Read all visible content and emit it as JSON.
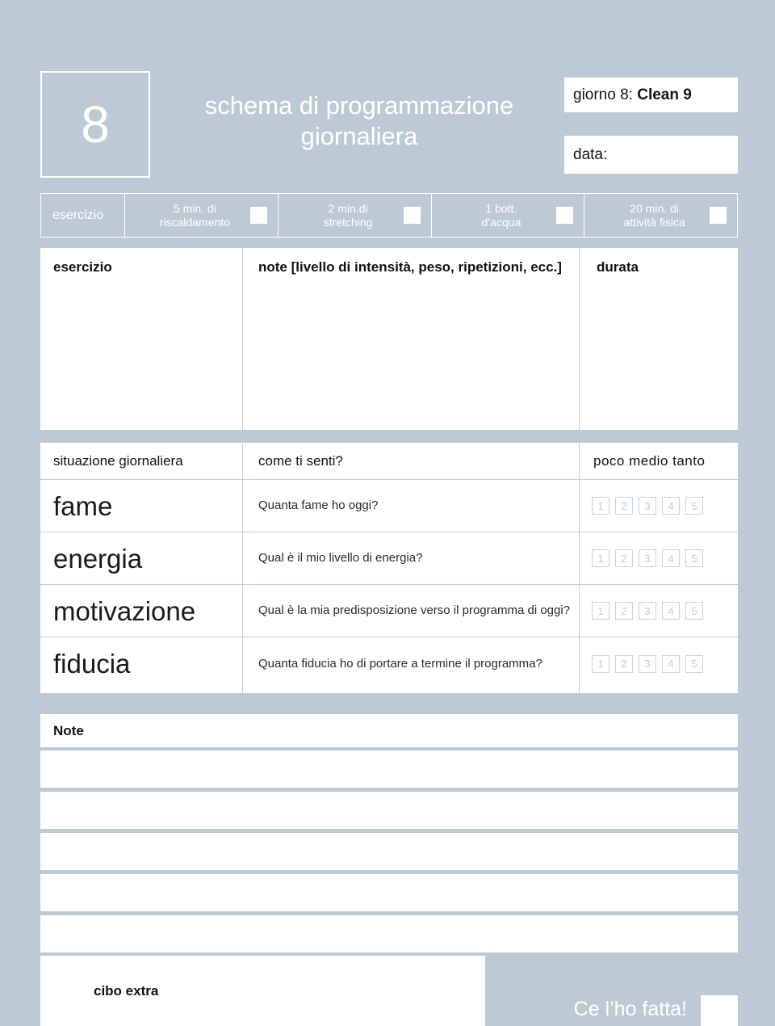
{
  "header": {
    "day_number": "8",
    "title_line1": "schema di programmazione",
    "title_line2": "giornaliera",
    "day_label_prefix": "giorno 8: ",
    "day_label_program": "Clean 9",
    "date_label": "data:"
  },
  "checklist": {
    "section_label": "esercizio",
    "tasks": [
      {
        "line1": "5 min. di",
        "line2": "riscaldamento",
        "checked": false
      },
      {
        "line1": "2 min.di",
        "line2": "stretching",
        "checked": false
      },
      {
        "line1": "1 bott.",
        "line2": "d’acqua",
        "checked": false
      },
      {
        "line1": "20 min. di",
        "line2": "attività fisica",
        "checked": false
      }
    ]
  },
  "exercise_table": {
    "col1_header": "esercizio",
    "col2_header": "note [livello di intensità, peso, ripetizioni, ecc.]",
    "col3_header": "durata",
    "rows": []
  },
  "situation_table": {
    "col1_header": "situazione giornaliera",
    "col2_header": "come ti senti?",
    "scale_header": "poco  medio  tanto",
    "scale_values": [
      "1",
      "2",
      "3",
      "4",
      "5"
    ],
    "rows": [
      {
        "name": "fame",
        "question": "Quanta fame ho oggi?",
        "selected": null
      },
      {
        "name": "energia",
        "question": "Qual è il mio livello di energia?",
        "selected": null
      },
      {
        "name": "motivazione",
        "question": "Qual è la mia predisposizione verso il programma di oggi?",
        "selected": null
      },
      {
        "name": "fiducia",
        "question": "Quanta fiducia ho di portare a termine il programma?",
        "selected": null
      }
    ]
  },
  "notes": {
    "header": "Note",
    "lines": [
      "",
      "",
      "",
      "",
      ""
    ]
  },
  "footer": {
    "extra_food_label": "cibo extra",
    "done_label": "Ce l’ho fatta!",
    "done_checked": false
  },
  "colors": {
    "background": "#bdcad6",
    "paper": "#ffffff",
    "divider": "#c3cfdb",
    "rate_box_border": "#c8d2dc",
    "rate_box_text": "#c2ccd7",
    "text": "#111111"
  }
}
